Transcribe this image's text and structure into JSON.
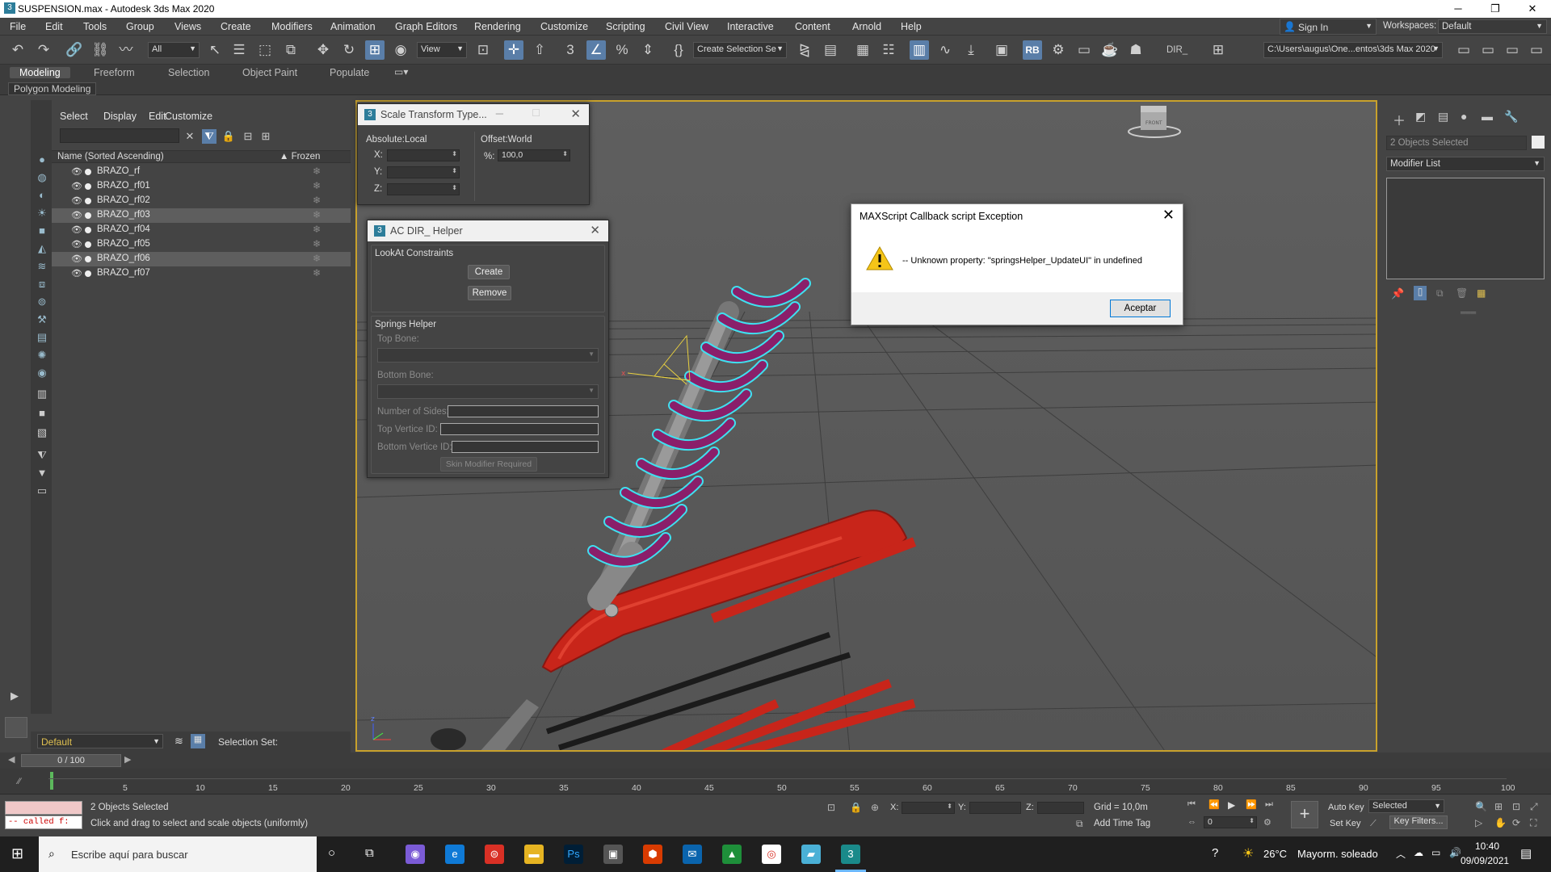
{
  "window": {
    "title": "SUSPENSION.max - Autodesk 3ds Max 2020",
    "min": "─",
    "max": "❐",
    "close": "✕"
  },
  "menu": [
    "File",
    "Edit",
    "Tools",
    "Group",
    "Views",
    "Create",
    "Modifiers",
    "Animation",
    "Graph Editors",
    "Rendering",
    "Customize",
    "Scripting",
    "Civil View",
    "Interactive",
    "Content",
    "Arnold",
    "Help"
  ],
  "account": {
    "sign_in": "Sign In",
    "workspaces_label": "Workspaces:",
    "workspace": "Default"
  },
  "toolbar": {
    "filter": "All",
    "ref_coord": "View",
    "selection_set": "Create Selection Se",
    "dir_label": "DIR_",
    "path": "C:\\Users\\augus\\One...entos\\3ds Max 2020"
  },
  "ribbon": {
    "tabs": [
      "Modeling",
      "Freeform",
      "Selection",
      "Object Paint",
      "Populate"
    ],
    "sub": "Polygon Modeling"
  },
  "scene_explorer": {
    "menu": [
      "Select",
      "Display",
      "Edit",
      "Customize"
    ],
    "col_name": "Name (Sorted Ascending)",
    "col_frozen": "▲ Frozen",
    "rows": [
      {
        "name": "BRAZO_rf"
      },
      {
        "name": "BRAZO_rf01"
      },
      {
        "name": "BRAZO_rf02"
      },
      {
        "name": "BRAZO_rf03"
      },
      {
        "name": "BRAZO_rf04"
      },
      {
        "name": "BRAZO_rf05"
      },
      {
        "name": "BRAZO_rf06"
      },
      {
        "name": "BRAZO_rf07"
      }
    ],
    "frozen_glyph": "❄",
    "layer": "Default",
    "selection_set_label": "Selection Set:"
  },
  "scale_dialog": {
    "title": "Scale Transform Type...",
    "abs_label": "Absolute:Local",
    "off_label": "Offset:World",
    "x": "X:",
    "y": "Y:",
    "z": "Z:",
    "pct_label": "%:",
    "pct_value": "100,0"
  },
  "ac_dialog": {
    "title": "AC DIR_ Helper",
    "lookat_title": "LookAt Constraints",
    "create": "Create",
    "remove": "Remove",
    "springs_title": "Springs Helper",
    "top_bone": "Top Bone:",
    "bottom_bone": "Bottom Bone:",
    "num_sides": "Number of Sides:",
    "top_vertex": "Top Vertice ID:",
    "bottom_vertex": "Bottom Vertice ID:",
    "skin_btn": "Skin Modifier Required"
  },
  "error_dialog": {
    "title": "MAXScript Callback script Exception",
    "message": "-- Unknown property: \"springsHelper_UpdateUI\" in undefined",
    "ok": "Aceptar"
  },
  "viewcube_label": "FRONT",
  "modify_panel": {
    "objects_selected": "2 Objects Selected",
    "modifier_list": "Modifier List"
  },
  "time": {
    "frame_display": "0 / 100",
    "ticks": [
      "5",
      "10",
      "15",
      "20",
      "25",
      "30",
      "35",
      "40",
      "45",
      "50",
      "55",
      "60",
      "65",
      "70",
      "75",
      "80",
      "85",
      "90",
      "95",
      "100"
    ]
  },
  "status": {
    "listener": "-- called f:",
    "selected": "2 Objects Selected",
    "prompt": "Click and drag to select and scale objects (uniformly)",
    "x": "X:",
    "y": "Y:",
    "z": "Z:",
    "grid": "Grid = 10,0m",
    "add_time_tag": "Add Time Tag",
    "auto_key": "Auto Key",
    "key_mode": "Selected",
    "set_key": "Set Key",
    "key_filters": "Key Filters...",
    "frame": "0"
  },
  "taskbar": {
    "search": "Escribe aquí para buscar",
    "temp": "26°C",
    "weather": "Mayorm. soleado",
    "time": "10:40",
    "date": "09/09/2021"
  },
  "colors": {
    "accent": "#5a7ea8",
    "viewport_border": "#c8a12c",
    "spring": "#8a1f6a",
    "arm": "#c8251a",
    "highlight": "#3fe0f0"
  }
}
